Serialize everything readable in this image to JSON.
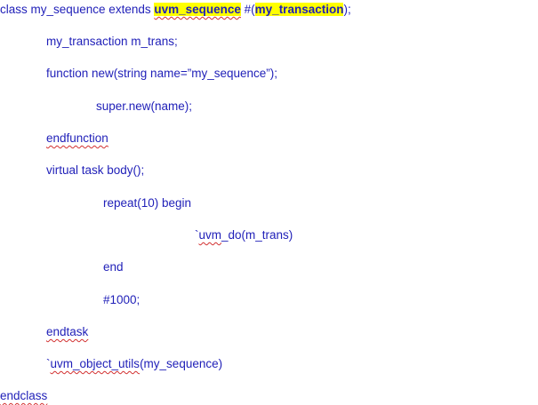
{
  "code": {
    "line1": {
      "prefix": "class my_sequence extends ",
      "base_class": "uvm_sequence",
      "hash_paren": " #(",
      "param": "my_transaction",
      "suffix": ");"
    },
    "line2": "my_transaction m_trans;",
    "line3": "function new(string name=”my_sequence”);",
    "line4": "super.new(name);",
    "line5": "endfunction",
    "line6": "virtual task body();",
    "line7": "repeat(10) begin",
    "line8": {
      "tick": "`",
      "macro": "uvm",
      "rest": "_do(m_trans)"
    },
    "line9": "end",
    "line10": "#1000;",
    "line11": "endtask",
    "line12": {
      "tick": "`",
      "macro": "uvm_object_utils",
      "rest": "(my_sequence)"
    },
    "line13": "endclass"
  },
  "colors": {
    "text": "#1f1fb8",
    "highlight": "#ffff00",
    "spellcheck": "#d23030"
  }
}
